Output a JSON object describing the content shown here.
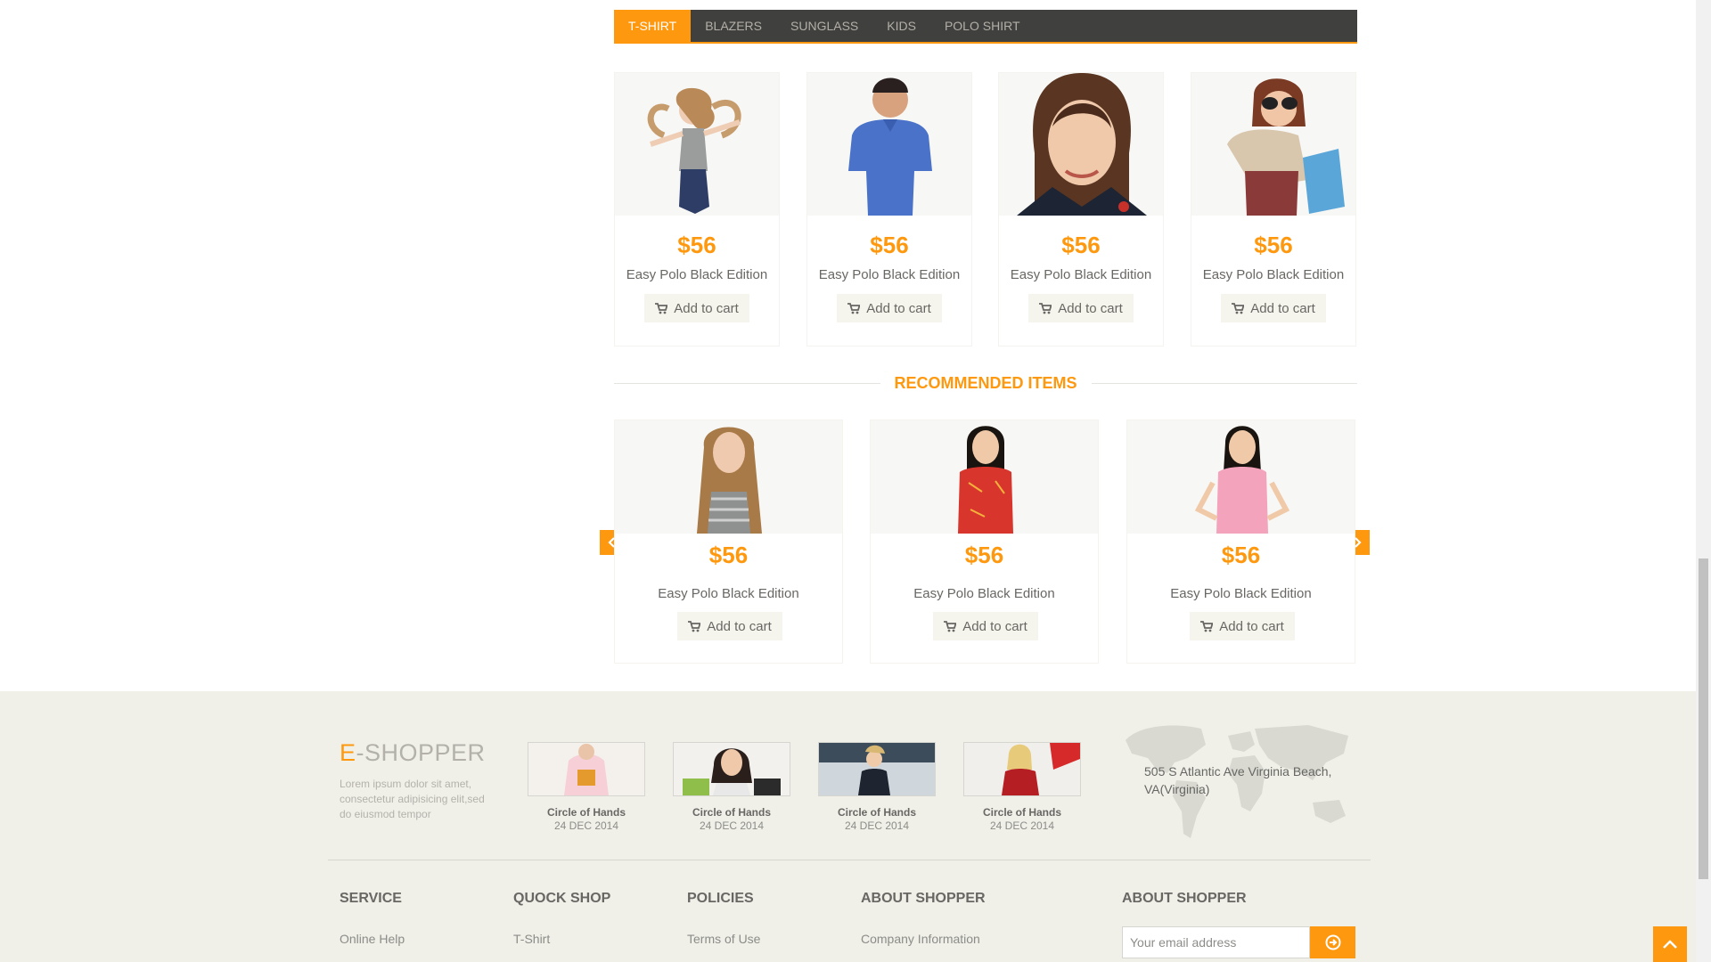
{
  "tabs": [
    "T-SHIRT",
    "BLAZERS",
    "SUNGLASS",
    "KIDS",
    "POLO SHIRT"
  ],
  "products": [
    {
      "price": "$56",
      "name": "Easy Polo Black Edition",
      "cart": "Add to cart"
    },
    {
      "price": "$56",
      "name": "Easy Polo Black Edition",
      "cart": "Add to cart"
    },
    {
      "price": "$56",
      "name": "Easy Polo Black Edition",
      "cart": "Add to cart"
    },
    {
      "price": "$56",
      "name": "Easy Polo Black Edition",
      "cart": "Add to cart"
    }
  ],
  "recommended": {
    "title": "RECOMMENDED ITEMS",
    "items": [
      {
        "price": "$56",
        "name": "Easy Polo Black Edition",
        "cart": "Add to cart"
      },
      {
        "price": "$56",
        "name": "Easy Polo Black Edition",
        "cart": "Add to cart"
      },
      {
        "price": "$56",
        "name": "Easy Polo Black Edition",
        "cart": "Add to cart"
      }
    ]
  },
  "footer": {
    "brand_e": "E",
    "brand_rest": "-SHOPPER",
    "brand_text": "Lorem ipsum dolor sit amet, consectetur adipisicing elit,sed do eiusmod tempor",
    "videos": [
      {
        "title": "Circle of Hands",
        "date": "24 DEC 2014"
      },
      {
        "title": "Circle of Hands",
        "date": "24 DEC 2014"
      },
      {
        "title": "Circle of Hands",
        "date": "24 DEC 2014"
      },
      {
        "title": "Circle of Hands",
        "date": "24 DEC 2014"
      }
    ],
    "address": "505 S Atlantic Ave Virginia Beach, VA(Virginia)",
    "columns": [
      {
        "head": "SERVICE",
        "link": "Online Help"
      },
      {
        "head": "QUOCK SHOP",
        "link": "T-Shirt"
      },
      {
        "head": "POLICIES",
        "link": "Terms of Use"
      },
      {
        "head": "ABOUT SHOPPER",
        "link": "Company Information"
      },
      {
        "head": "ABOUT SHOPPER",
        "link": ""
      }
    ],
    "email_placeholder": "Your email address"
  },
  "colors": {
    "accent": "#fe980f",
    "tabbar": "#40403e",
    "footer_bg": "#f0f0e9"
  }
}
